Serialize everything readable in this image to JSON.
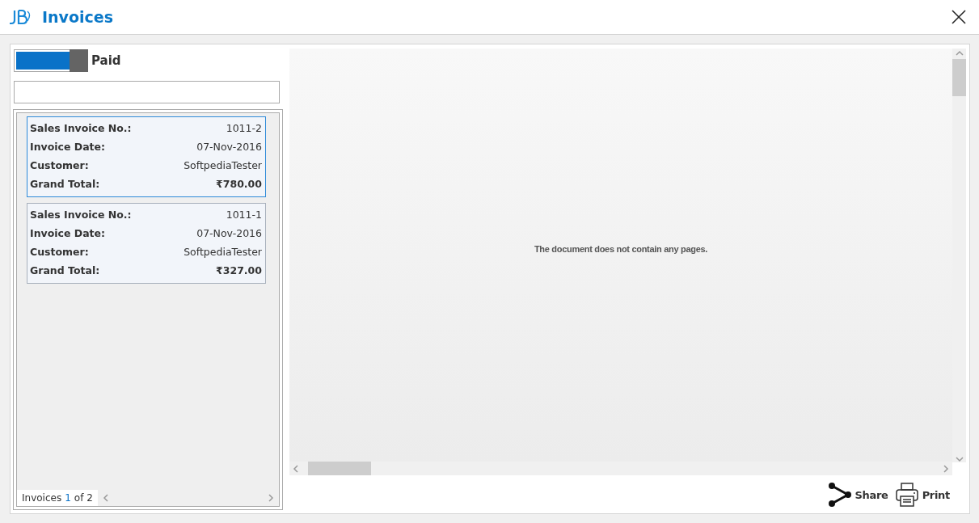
{
  "window": {
    "title": "Invoices"
  },
  "paid_toggle": {
    "label": "Paid",
    "on": true
  },
  "invoices": [
    {
      "selected": true,
      "fields": [
        {
          "label": "Sales Invoice No.:",
          "value": "1011-2",
          "bold": false
        },
        {
          "label": "Invoice Date:",
          "value": "07-Nov-2016",
          "bold": false
        },
        {
          "label": "Customer:",
          "value": "SoftpediaTester",
          "bold": false
        },
        {
          "label": "Grand Total:",
          "value": "₹780.00",
          "bold": true
        }
      ]
    },
    {
      "selected": false,
      "fields": [
        {
          "label": "Sales Invoice No.:",
          "value": "1011-1",
          "bold": false
        },
        {
          "label": "Invoice Date:",
          "value": "07-Nov-2016",
          "bold": false
        },
        {
          "label": "Customer:",
          "value": "SoftpediaTester",
          "bold": false
        },
        {
          "label": "Grand Total:",
          "value": "₹327.00",
          "bold": true
        }
      ]
    }
  ],
  "pager": {
    "label": "Invoices",
    "current": "1",
    "total": "of 2"
  },
  "viewer": {
    "message": "The document does not contain any pages."
  },
  "actions": [
    {
      "kind": "share",
      "label": "Share"
    },
    {
      "kind": "print",
      "label": "Print"
    }
  ]
}
